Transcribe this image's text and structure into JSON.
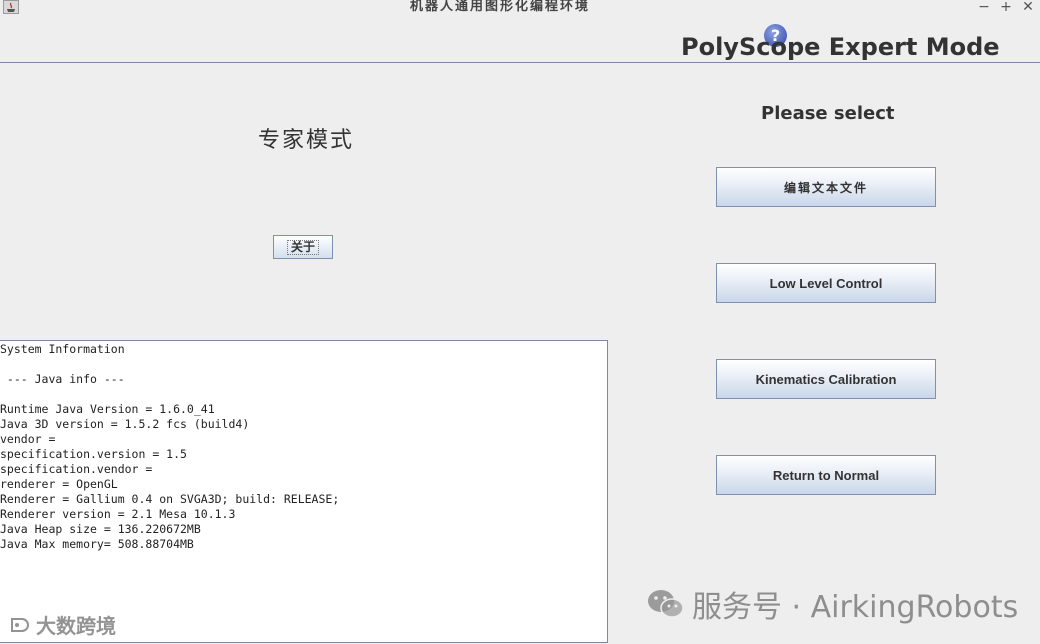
{
  "window": {
    "title": "机器人通用图形化编程环境",
    "controls": [
      "−",
      "+",
      "✕"
    ]
  },
  "header": {
    "help_icon_glyph": "?",
    "title": "PolyScope Expert Mode"
  },
  "left": {
    "mode_label": "专家模式",
    "about_button": "关于"
  },
  "system_info": {
    "lines": [
      "System Information",
      "",
      " --- Java info ---",
      "",
      "Runtime Java Version = 1.6.0_41",
      "Java 3D version = 1.5.2 fcs (build4)",
      "vendor =",
      "specification.version = 1.5",
      "specification.vendor =",
      "renderer = OpenGL",
      "Renderer = Gallium 0.4 on SVGA3D; build: RELEASE;",
      "Renderer version = 2.1 Mesa 10.1.3",
      "Java Heap size = 136.220672MB",
      "Java Max memory= 508.88704MB"
    ]
  },
  "right": {
    "prompt": "Please select",
    "buttons": {
      "edit_text_file": "编辑文本文件",
      "low_level_control": "Low Level Control",
      "kinematics_calibration": "Kinematics Calibration",
      "return_to_normal": "Return to Normal"
    }
  },
  "watermarks": {
    "right": "服务号 · AirkingRobots",
    "left": "大数跨境"
  },
  "colors": {
    "background": "#eeeeee",
    "button_border": "#7e92b0",
    "help_icon": "#4a5fb8"
  }
}
